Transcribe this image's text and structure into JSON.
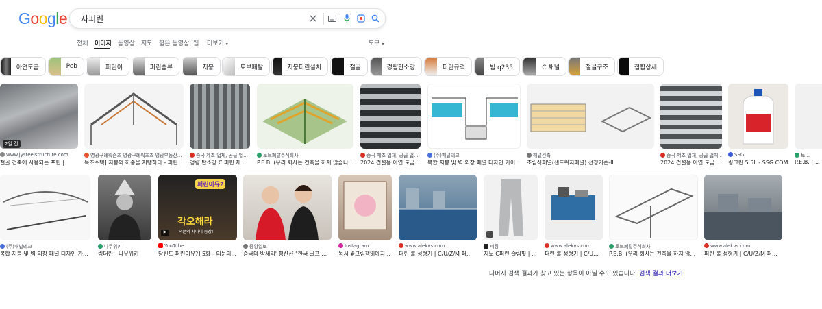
{
  "logo": {
    "text": "Google"
  },
  "search": {
    "query": "사퍼린"
  },
  "tabs": [
    {
      "label": "전체"
    },
    {
      "label": "이미지"
    },
    {
      "label": "동영상"
    },
    {
      "label": "지도"
    },
    {
      "label": "짧은 동영상"
    },
    {
      "label": "웹"
    },
    {
      "label": "더보기"
    }
  ],
  "tools": "도구",
  "chips": [
    {
      "label": "아연도금"
    },
    {
      "label": "Peb"
    },
    {
      "label": "퍼린이"
    },
    {
      "label": "퍼린종류"
    },
    {
      "label": "지붕"
    },
    {
      "label": "토브폐탈"
    },
    {
      "label": "지붕퍼린설치"
    },
    {
      "label": "철골"
    },
    {
      "label": "경량탄소강"
    },
    {
      "label": "퍼린규격"
    },
    {
      "label": "빔 q235"
    },
    {
      "label": "C 채널"
    },
    {
      "label": "철골구조"
    },
    {
      "label": "접합상세"
    }
  ],
  "row1": [
    {
      "src": "www.jysteelstructure.com",
      "title": "철골 건축에 사용되는 프린 |",
      "badge": "2일 전"
    },
    {
      "src": "영광구례워줌즈 영광구례워즈즈 영광부동산...",
      "title": "목조주택] 지붕의 하중을 지탱하다 - 퍼린..."
    },
    {
      "src": "중국 제조 업체, 공급 업...",
      "title": "경량 탄소강 C 퍼린 채..."
    },
    {
      "src": "토브폐탈주식회사",
      "title": "P.E.B. (우리 회사는 건축을 하지 않습니..."
    },
    {
      "src": "중국 제조 업체, 공급 업...",
      "title": "2024 건설용 아연 도금 ..."
    },
    {
      "src": "(주)패널테크",
      "title": "복합 지붕 및 벽 외장 패널 디자인 가이..."
    },
    {
      "src": "해널건축",
      "title": "조립식패널(샌드위치패널) 선정기준-II"
    },
    {
      "src": "중국 제조 업체, 공급 업체...",
      "title": "2024 건설용 아연 도금 ..."
    },
    {
      "src": "SSG",
      "title": "링크린 5.5L - SSG.COM"
    },
    {
      "src": "토...",
      "title": "P.E.B. (..."
    }
  ],
  "row2": [
    {
      "src": "(주)패널테크",
      "title": "복합 지붕 및 벽 외장 패널 디자인 가이..."
    },
    {
      "src": "나무위키",
      "title": "링더린 - 나무위키"
    },
    {
      "src": "YouTube",
      "title": "당신도 퍼린이유?] 5화 - 의문의..."
    },
    {
      "src": "중앙일보",
      "title": "중국의 박세리' 펑샨샨 \"한국 골프 배..."
    },
    {
      "src": "Instagram",
      "title": "독서 #그림책읽예치..."
    },
    {
      "src": "www.alekvs.com",
      "title": "퍼린 롤 성형기 | C/U/Z/M 퍼린 ..."
    },
    {
      "src": "퍼징",
      "title": "치노 C퍼린 슬림핏 | ..."
    },
    {
      "src": "www.alekvs.com",
      "title": "퍼린 롤 성형기 | C/U..."
    },
    {
      "src": "토브폐탈주식회사",
      "title": "P.E.B. (우리 회사는 건축을 하지 않..."
    },
    {
      "src": "www.alekvs.com",
      "title": "퍼린 롤 성형기 | C/U/Z/M 퍼린 ..."
    }
  ],
  "video_overlay": {
    "top": "퍼린이유?",
    "bottom": "각오해라",
    "sub": "의문의 사나이 등장!"
  },
  "footer": {
    "text": "나머지 검색 결과가 찾고 있는 항목이 아닐 수도 있습니다.",
    "link": "검색 결과 더보기"
  }
}
